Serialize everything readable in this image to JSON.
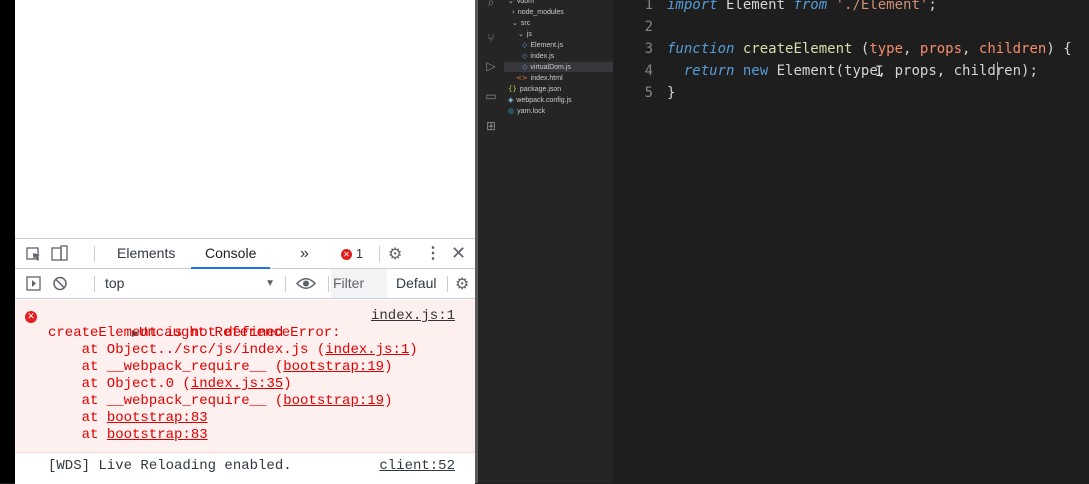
{
  "devtools": {
    "tabs": {
      "elements": "Elements",
      "console": "Console",
      "more": "»",
      "error_count": "1"
    },
    "console_bar": {
      "context": "top",
      "filter_placeholder": "Filter",
      "levels": "Defaul"
    },
    "error": {
      "line1": "Uncaught ReferenceError:",
      "line2": "createElement is not defined",
      "source": "index.js:1",
      "stack": [
        {
          "prefix": "    at Object../src/js/index.js (",
          "link": "index.js:1",
          "suffix": ")"
        },
        {
          "prefix": "    at __webpack_require__ (",
          "link": "bootstrap:19",
          "suffix": ")"
        },
        {
          "prefix": "    at Object.0 (",
          "link": "index.js:35",
          "suffix": ")"
        },
        {
          "prefix": "    at __webpack_require__ (",
          "link": "bootstrap:19",
          "suffix": ")"
        },
        {
          "prefix": "    at ",
          "link": "bootstrap:83",
          "suffix": ""
        },
        {
          "prefix": "    at ",
          "link": "bootstrap:83",
          "suffix": ""
        }
      ]
    },
    "log": {
      "text": "[WDS] Live Reloading enabled.",
      "source": "client:52"
    }
  },
  "explorer": {
    "items": [
      {
        "label": "vdom",
        "icon": "chevron-down-icon"
      },
      {
        "label": "node_modules",
        "icon": "chevron-right-icon"
      },
      {
        "label": "src",
        "icon": "chevron-down-icon"
      },
      {
        "label": "js",
        "icon": "chevron-down-icon"
      },
      {
        "label": "Element.js",
        "icon": "js-file-icon"
      },
      {
        "label": "index.js",
        "icon": "js-file-icon"
      },
      {
        "label": "virtualDom.js",
        "icon": "js-file-icon"
      },
      {
        "label": "index.html",
        "icon": "html-file-icon"
      },
      {
        "label": "package.json",
        "icon": "json-file-icon"
      },
      {
        "label": "webpack.config.js",
        "icon": "webpack-file-icon"
      },
      {
        "label": "yarn.lock",
        "icon": "yarn-file-icon"
      }
    ]
  },
  "editor": {
    "lines": [
      {
        "num": "1",
        "tokens": [
          {
            "t": "import",
            "c": "kw-i"
          },
          {
            "t": " Element ",
            "c": "plain"
          },
          {
            "t": "from",
            "c": "kw-i"
          },
          {
            "t": " ",
            "c": "plain"
          },
          {
            "t": "'./Element'",
            "c": "str"
          },
          {
            "t": ";",
            "c": "plain"
          }
        ]
      },
      {
        "num": "2",
        "tokens": []
      },
      {
        "num": "3",
        "tokens": [
          {
            "t": "function",
            "c": "kw-i"
          },
          {
            "t": " ",
            "c": "plain"
          },
          {
            "t": "createElement",
            "c": "fn"
          },
          {
            "t": " (",
            "c": "plain"
          },
          {
            "t": "type",
            "c": "param"
          },
          {
            "t": ", ",
            "c": "plain"
          },
          {
            "t": "props",
            "c": "param"
          },
          {
            "t": ", ",
            "c": "plain"
          },
          {
            "t": "children",
            "c": "param"
          },
          {
            "t": ") {",
            "c": "plain"
          }
        ]
      },
      {
        "num": "4",
        "tokens": [
          {
            "t": "  ",
            "c": "plain"
          },
          {
            "t": "return",
            "c": "kw-i"
          },
          {
            "t": " ",
            "c": "plain"
          },
          {
            "t": "new",
            "c": "kw"
          },
          {
            "t": " Element(type, props, children);",
            "c": "plain"
          }
        ]
      },
      {
        "num": "5",
        "tokens": [
          {
            "t": "}",
            "c": "brace"
          }
        ]
      }
    ]
  }
}
